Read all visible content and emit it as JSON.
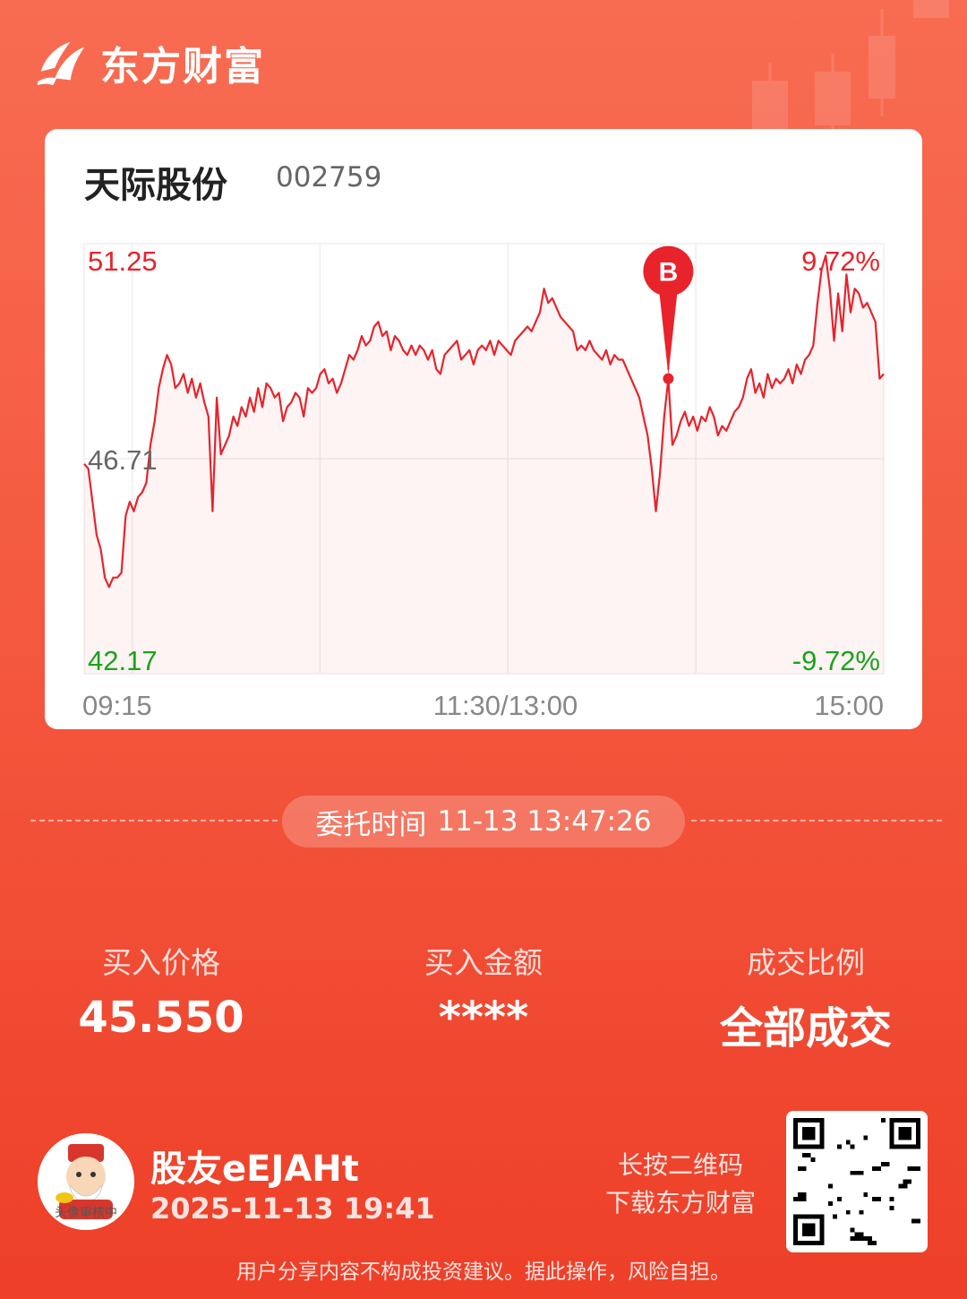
{
  "brand": {
    "name": "东方财富",
    "logo": "eastmoney-logo-icon"
  },
  "stock": {
    "name": "天际股份",
    "code": "002759"
  },
  "chart_data": {
    "type": "line",
    "y_labels": {
      "high": "51.25",
      "mid": "46.71",
      "low": "42.17"
    },
    "pct_labels": {
      "high": "9.72%",
      "low": "-9.72%"
    },
    "x_labels": [
      "09:15",
      "11:30/13:00",
      "15:00"
    ],
    "ylim": [
      42.17,
      51.25
    ],
    "line_color": "#e8232b",
    "up_color": "#e8232b",
    "down_color": "#1aa31a",
    "series": [
      {
        "values": [
          46.6,
          46.5,
          45.8,
          45.1,
          44.8,
          44.2,
          44.0,
          44.2,
          44.2,
          44.3,
          45.5,
          45.8,
          45.6,
          45.9,
          46.0,
          46.2,
          47.0,
          47.5,
          48.2,
          48.6,
          48.9,
          48.7,
          48.2,
          48.3,
          48.5,
          48.1,
          48.4,
          48.0,
          48.3,
          47.9,
          47.6,
          45.6,
          48.0,
          46.8,
          47.0,
          47.2,
          47.6,
          47.4,
          47.8,
          47.6,
          48.0,
          47.7,
          48.2,
          47.8,
          48.3,
          48.2,
          48.0,
          48.1,
          47.5,
          47.8,
          47.9,
          48.1,
          48.0,
          47.6,
          48.2,
          48.1,
          48.2,
          48.5,
          48.6,
          48.3,
          48.4,
          48.1,
          48.3,
          48.6,
          48.9,
          48.8,
          49.0,
          49.3,
          49.1,
          49.2,
          49.5,
          49.6,
          49.3,
          49.4,
          49.0,
          49.3,
          49.2,
          49.0,
          48.9,
          49.1,
          48.9,
          49.1,
          49.0,
          48.8,
          49.0,
          48.6,
          48.5,
          48.9,
          49.0,
          49.1,
          49.2,
          48.8,
          48.9,
          49.0,
          48.7,
          49.0,
          49.1,
          49.0,
          49.2,
          48.9,
          49.2,
          49.1,
          49.0,
          48.9,
          49.2,
          49.3,
          49.4,
          49.5,
          49.4,
          49.6,
          49.8,
          50.3,
          50.0,
          50.1,
          49.9,
          49.7,
          49.6,
          49.5,
          49.4,
          49.0,
          49.1,
          49.0,
          49.2,
          49.0,
          48.9,
          48.8,
          49.0,
          48.7,
          48.9,
          48.8,
          48.8,
          48.6,
          48.4,
          48.2,
          48.0,
          47.6,
          47.2,
          46.5,
          45.6,
          46.4,
          47.6,
          48.4,
          47.0,
          47.2,
          47.5,
          47.7,
          47.4,
          47.6,
          47.3,
          47.6,
          47.5,
          47.8,
          47.6,
          47.2,
          47.4,
          47.3,
          47.5,
          47.7,
          47.8,
          48.0,
          48.4,
          48.6,
          48.1,
          48.3,
          48.0,
          48.5,
          48.2,
          48.4,
          48.3,
          48.4,
          48.6,
          48.3,
          48.7,
          48.5,
          48.8,
          48.9,
          49.1,
          50.0,
          50.7,
          51.0,
          50.3,
          49.2,
          50.2,
          49.4,
          50.6,
          49.8,
          50.3,
          50.2,
          49.9,
          50.0,
          49.8,
          49.6,
          48.4,
          48.5
        ]
      }
    ],
    "buy_marker": {
      "label": "B",
      "index": 141
    }
  },
  "order": {
    "label": "委托时间",
    "value": "11-13 13:47:26"
  },
  "stats": [
    {
      "label": "买入价格",
      "value": "45.550"
    },
    {
      "label": "买入金额",
      "value": "****"
    },
    {
      "label": "成交比例",
      "value": "全部成交"
    }
  ],
  "user": {
    "name": "股友eEJAHt",
    "time": "2025-11-13 19:41",
    "avatar_caption": "头像审核中"
  },
  "qr": {
    "tip_line1": "长按二维码",
    "tip_line2": "下载东方财富"
  },
  "disclaimer": "用户分享内容不构成投资建议。据此操作，风险自担。"
}
